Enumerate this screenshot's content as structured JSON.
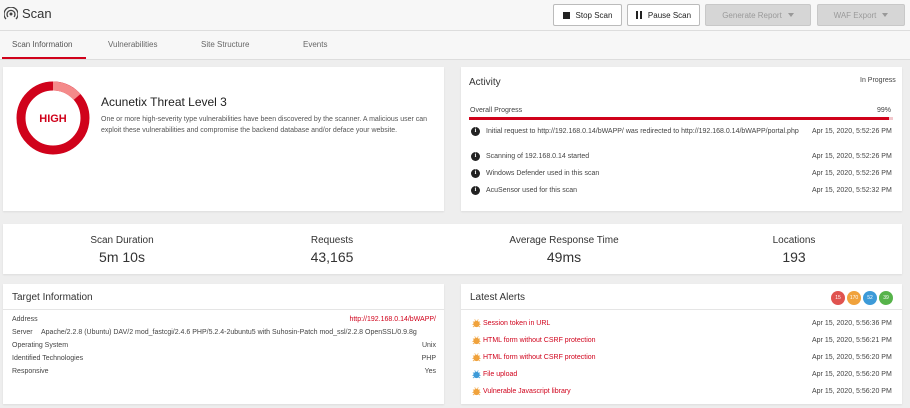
{
  "header": {
    "title": "Scan",
    "stop_label": "Stop Scan",
    "pause_label": "Pause Scan",
    "report_label": "Generate Report",
    "waf_label": "WAF Export"
  },
  "tabs": [
    "Scan Information",
    "Vulnerabilities",
    "Site Structure",
    "Events"
  ],
  "threat": {
    "level_badge": "HIGH",
    "title": "Acunetix Threat Level 3",
    "description": "One or more high-severity type vulnerabilities have been discovered by the scanner. A malicious user can exploit these vulnerabilities and compromise the backend database and/or deface your website."
  },
  "activity": {
    "title": "Activity",
    "status": "In Progress",
    "progress_label": "Overall Progress",
    "progress_value": "99%",
    "progress_fraction": 0.99,
    "events": [
      {
        "text": "Initial request to http://192.168.0.14/bWAPP/ was redirected to http://192.168.0.14/bWAPP/portal.php",
        "time": "Apr 15, 2020, 5:52:26 PM"
      },
      {
        "text": "Scanning of 192.168.0.14 started",
        "time": "Apr 15, 2020, 5:52:26 PM"
      },
      {
        "text": "Windows Defender used in this scan",
        "time": "Apr 15, 2020, 5:52:26 PM"
      },
      {
        "text": "AcuSensor used for this scan",
        "time": "Apr 15, 2020, 5:52:32 PM"
      }
    ]
  },
  "stats": [
    {
      "label": "Scan Duration",
      "value": "5m 10s"
    },
    {
      "label": "Requests",
      "value": "43,165"
    },
    {
      "label": "Average Response Time",
      "value": "49ms"
    },
    {
      "label": "Locations",
      "value": "193"
    }
  ],
  "target": {
    "title": "Target Information",
    "address_label": "Address",
    "address_value": "http://192.168.0.14/bWAPP/",
    "server_label": "Server",
    "server_value": "Apache/2.2.8 (Ubuntu) DAV/2 mod_fastcgi/2.4.6 PHP/5.2.4-2ubuntu5 with Suhosin-Patch mod_ssl/2.2.8 OpenSSL/0.9.8g",
    "os_label": "Operating System",
    "os_value": "Unix",
    "tech_label": "Identified Technologies",
    "tech_value": "PHP",
    "responsive_label": "Responsive",
    "responsive_value": "Yes"
  },
  "alerts": {
    "title": "Latest Alerts",
    "counts": [
      {
        "value": "15",
        "color": "#e0534f"
      },
      {
        "value": "170",
        "color": "#f0a23c"
      },
      {
        "value": "52",
        "color": "#3c9ad8"
      },
      {
        "value": "39",
        "color": "#56b34a"
      }
    ],
    "items": [
      {
        "name": "Session token in URL",
        "time": "Apr 15, 2020, 5:56:36 PM",
        "severity": "medium"
      },
      {
        "name": "HTML form without CSRF protection",
        "time": "Apr 15, 2020, 5:56:21 PM",
        "severity": "medium"
      },
      {
        "name": "HTML form without CSRF protection",
        "time": "Apr 15, 2020, 5:56:20 PM",
        "severity": "medium"
      },
      {
        "name": "File upload",
        "time": "Apr 15, 2020, 5:56:20 PM",
        "severity": "low"
      },
      {
        "name": "Vulnerable Javascript library",
        "time": "Apr 15, 2020, 5:56:20 PM",
        "severity": "medium"
      }
    ]
  },
  "colors": {
    "accent": "#d0021b",
    "medium": "#f0a23c",
    "low": "#3c9ad8"
  }
}
